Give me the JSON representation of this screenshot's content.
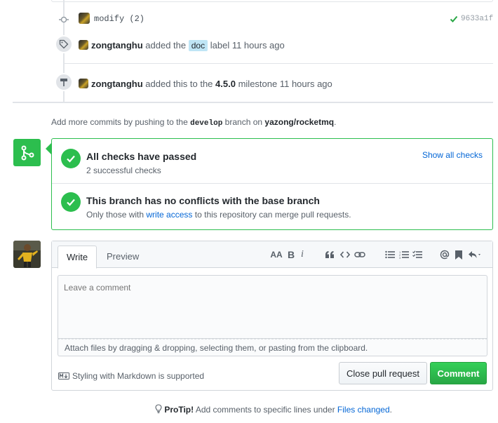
{
  "timeline": {
    "commit": {
      "message": "modify (2)",
      "sha": "9633a1f"
    },
    "label_event": {
      "user": "zongtanghu",
      "action": "added the",
      "label": "doc",
      "suffix": "label 11 hours ago"
    },
    "milestone_event": {
      "user": "zongtanghu",
      "action": "added this to the",
      "milestone": "4.5.0",
      "suffix": "milestone 11 hours ago"
    }
  },
  "hint": {
    "prefix": "Add more commits by pushing to the",
    "branch": "develop",
    "middle": "branch on",
    "repo": "yazong/rocketmq",
    "end": "."
  },
  "merge": {
    "checks_title": "All checks have passed",
    "checks_sub": "2 successful checks",
    "show_all": "Show all checks",
    "conflict_title": "This branch has no conflicts with the base branch",
    "conflict_sub_prefix": "Only those with",
    "conflict_link": "write access",
    "conflict_sub_suffix": "to this repository can merge pull requests."
  },
  "comment": {
    "tab_write": "Write",
    "tab_preview": "Preview",
    "placeholder": "Leave a comment",
    "attach": "Attach files by dragging & dropping, selecting them, or pasting from the clipboard.",
    "markdown_note": "Styling with Markdown is supported",
    "close_button": "Close pull request",
    "comment_button": "Comment",
    "toolbar": {
      "heading": "AA",
      "bold": "B",
      "italic": "i"
    }
  },
  "protip": {
    "label": "ProTip!",
    "text": "Add comments to specific lines under",
    "link": "Files changed",
    "end": "."
  },
  "colors": {
    "success": "#2cbe4e",
    "link": "#0366d6",
    "label_doc": "#bfe5f5"
  }
}
